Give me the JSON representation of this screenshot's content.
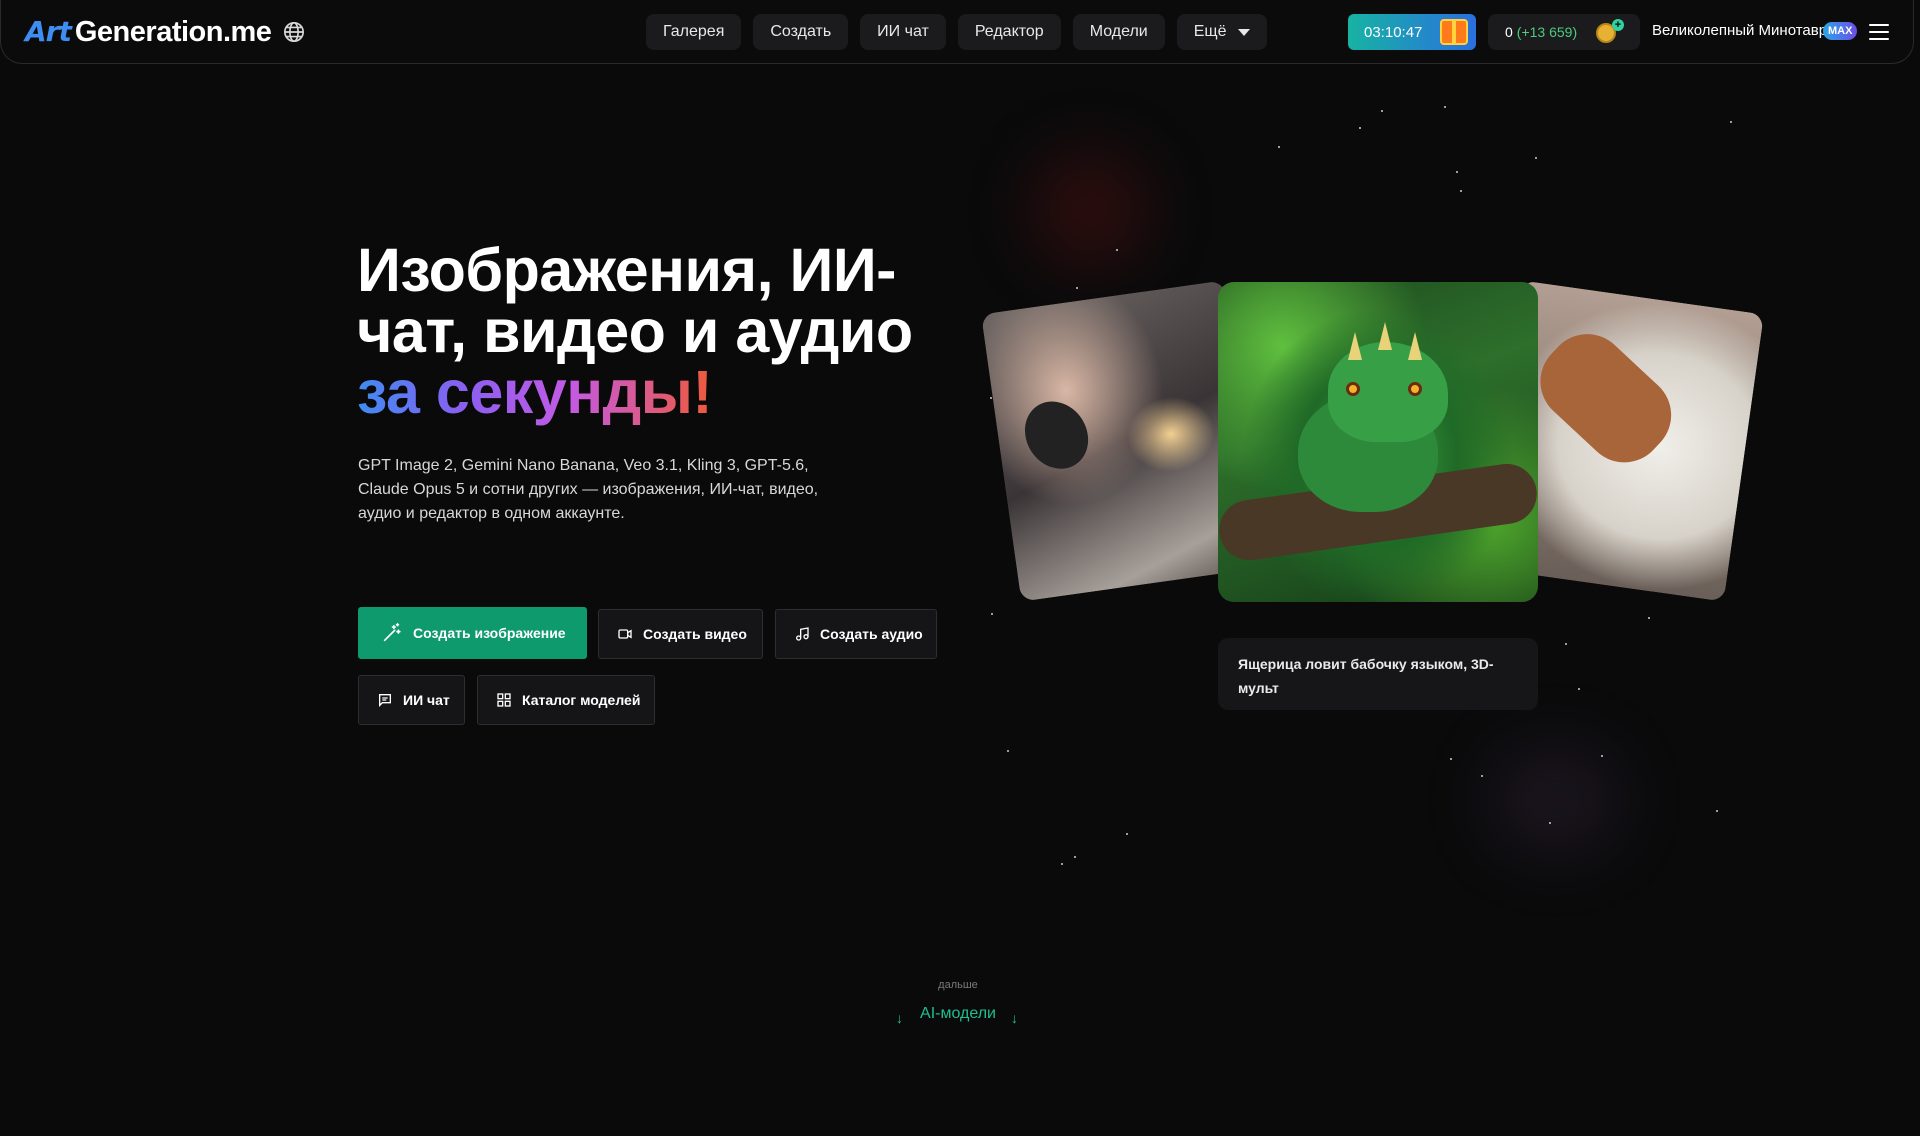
{
  "header": {
    "logo_art": "Art",
    "logo_text": "Generation.me",
    "nav": [
      "Галерея",
      "Создать",
      "ИИ чат",
      "Редактор",
      "Модели"
    ],
    "nav_more": "Ещё",
    "timer": "03:10:47",
    "balance": "0",
    "balance_bonus": "(+13 659)",
    "user_name": "Великолепный Минотавр",
    "badge": "MAX"
  },
  "hero": {
    "title_line1": "Изображения, ИИ-",
    "title_line2": "чат, видео и аудио",
    "title_grad": "за секунды!",
    "description": "GPT Image 2, Gemini Nano Banana, Veo 3.1, Kling 3, GPT-5.6, Claude Opus 5 и сотни других — изображения, ИИ-чат, видео, аудио и редактор в одном аккаунте.",
    "buttons": {
      "create_image": "Создать изображение",
      "create_video": "Создать видео",
      "create_audio": "Создать аудио",
      "ai_chat": "ИИ чат",
      "catalog": "Каталог моделей"
    },
    "caption": "Ящерица ловит бабочку языком, 3D-мульт"
  },
  "footer": {
    "more": "дальше",
    "link": "AI-модели"
  },
  "colors": {
    "primary_button": "#0f9a6e",
    "accent_green": "#1fbf8f",
    "background": "#0a0a0b"
  },
  "icons": [
    "globe-icon",
    "chevron-down-icon",
    "gift-icon",
    "coin-icon",
    "menu-icon",
    "magic-wand-icon",
    "video-icon",
    "music-note-icon",
    "chat-icon",
    "grid-icon",
    "arrow-down-icon"
  ]
}
